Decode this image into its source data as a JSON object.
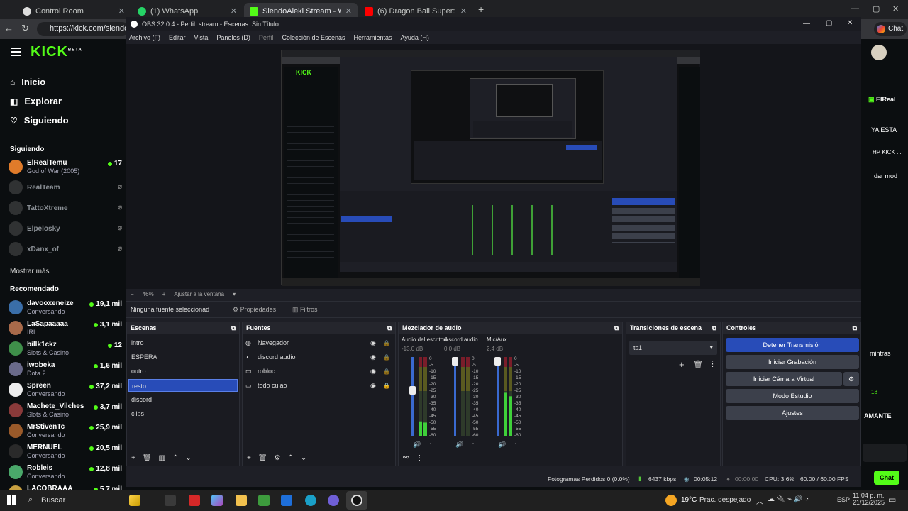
{
  "browser": {
    "tabs": [
      {
        "label": "Control Room",
        "color": "#ffffff"
      },
      {
        "label": "(1) WhatsApp",
        "color": "#25d366"
      },
      {
        "label": "SiendoAleki Stream - Watch Live o",
        "color": "#53fc18"
      },
      {
        "label": "(6) Dragon Ball Super: Broly |",
        "color": "#ff0000"
      }
    ],
    "url": "https://kick.com/siendoal",
    "chat_label": "Chat"
  },
  "kick": {
    "logo": "KICK",
    "logo_sup": "BETA",
    "nav": [
      {
        "label": "Inicio",
        "icon": "home-icon"
      },
      {
        "label": "Explorar",
        "icon": "compass-icon"
      },
      {
        "label": "Siguiendo",
        "icon": "heart-icon"
      }
    ],
    "following_title": "Siguiendo",
    "following": [
      {
        "name": "ElRealTemu",
        "sub": "God of War (2005)",
        "viewers": "17",
        "online": true,
        "color": "#e07b2a"
      },
      {
        "name": "RealTeam",
        "sub": "",
        "viewers": "",
        "online": false,
        "color": "#555"
      },
      {
        "name": "TattoXtreme",
        "sub": "",
        "viewers": "",
        "online": false,
        "color": "#555"
      },
      {
        "name": "Elpelosky",
        "sub": "",
        "viewers": "",
        "online": false,
        "color": "#555"
      },
      {
        "name": "xDanx_of",
        "sub": "",
        "viewers": "",
        "online": false,
        "color": "#555"
      }
    ],
    "show_more": "Mostrar más",
    "recommended_title": "Recomendado",
    "recommended": [
      {
        "name": "davooxeneize",
        "sub": "Conversando",
        "viewers": "19,1 mil",
        "color": "#3a6ea8"
      },
      {
        "name": "LaSapaaaaa",
        "sub": "IRL",
        "viewers": "3,1 mil",
        "color": "#a86a4a"
      },
      {
        "name": "billk1ckz",
        "sub": "Slots & Casino",
        "viewers": "12",
        "color": "#3f8f4a"
      },
      {
        "name": "iwobeka",
        "sub": "Dota 2",
        "viewers": "1,6 mil",
        "color": "#6a6a8a"
      },
      {
        "name": "Spreen",
        "sub": "Conversando",
        "viewers": "37,2 mil",
        "color": "#eeeeee"
      },
      {
        "name": "Machete_Vilches",
        "sub": "Slots & Casino",
        "viewers": "3,7 mil",
        "color": "#8a3a3a"
      },
      {
        "name": "MrStivenTc",
        "sub": "Conversando",
        "viewers": "25,9 mil",
        "color": "#9a5a2a"
      },
      {
        "name": "MERNUEL",
        "sub": "Conversando",
        "viewers": "20,5 mil",
        "color": "#2a2a2a"
      },
      {
        "name": "Robleis",
        "sub": "Conversando",
        "viewers": "12,8 mil",
        "color": "#4aa86a"
      },
      {
        "name": "LACOBRAAA",
        "sub": "",
        "viewers": "5,7 mil",
        "color": "#c8a040"
      }
    ]
  },
  "right_chat": {
    "lines": [
      "ElReal",
      "YA ESTA",
      "HP KICK ...",
      "dar mod",
      "AMANTE",
      "mintras",
      "18",
      "AMANTE"
    ]
  },
  "obs": {
    "title": "OBS 32.0.4 - Perfil: stream - Escenas: Sin Título",
    "menu": [
      "Archivo (F)",
      "Editar",
      "Vista",
      "Paneles (D)",
      "Perfil",
      "Colección de Escenas",
      "Herramientas",
      "Ayuda (H)"
    ],
    "zoom": "46%",
    "fit_label": "Ajustar a la ventana",
    "no_source": "Ninguna fuente seleccionad",
    "properties": "Propiedades",
    "filters": "Filtros",
    "scenes_title": "Escenas",
    "scenes": [
      "intro",
      "ESPERA",
      "outro",
      "resto",
      "discord",
      "clips"
    ],
    "selected_scene": 3,
    "sources_title": "Fuentes",
    "sources": [
      {
        "label": "Navegador",
        "icon": "globe-icon"
      },
      {
        "label": "discord audio",
        "icon": "speaker-icon"
      },
      {
        "label": "robloc",
        "icon": "window-icon"
      },
      {
        "label": "todo cuiao",
        "icon": "window-icon"
      }
    ],
    "mixer_title": "Mezclador de audio",
    "channels": [
      {
        "name": "Audio del escritorio",
        "db": "-13.0 dB",
        "level": 0.19,
        "fader": 0.62
      },
      {
        "name": "discord audio",
        "db": "0.0 dB",
        "level": 0.0,
        "fader": 1.0
      },
      {
        "name": "Mic/Aux",
        "db": "2.4 dB",
        "level": 0.55,
        "fader": 1.0
      }
    ],
    "meter_ticks": [
      "0",
      "-5",
      "-10",
      "-15",
      "-20",
      "-25",
      "-30",
      "-35",
      "-40",
      "-45",
      "-50",
      "-55",
      "-60"
    ],
    "transitions_title": "Transiciones de escena",
    "transition": "ts1",
    "controls_title": "Controles",
    "controls": [
      "Detener Transmisión",
      "Iniciar Grabación",
      "Iniciar Cámara Virtual",
      "Modo Estudio",
      "Ajustes"
    ],
    "status": {
      "dropped": "Fotogramas Perdidos 0 (0.0%)",
      "kbps": "6437 kbps",
      "live_time": "00:05:12",
      "rec_time": "00:00:00",
      "cpu": "CPU: 3.6%",
      "fps": "60.00 / 60.00 FPS"
    }
  },
  "taskbar": {
    "search": "Buscar",
    "weather": "19°C",
    "weather_desc": "Prac. despejado",
    "lang": "ESP",
    "time": "11:04 p. m.",
    "date": "21/12/2025"
  }
}
